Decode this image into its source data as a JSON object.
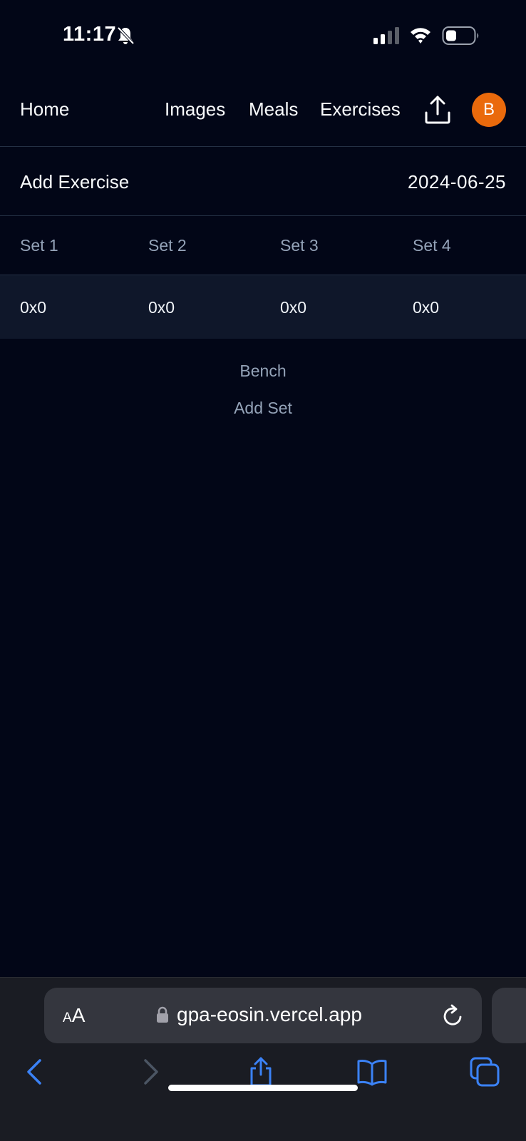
{
  "status_bar": {
    "time": "11:17",
    "icons": [
      "bell-slash-icon",
      "cellular-signal-icon",
      "wifi-icon",
      "battery-icon"
    ]
  },
  "nav": {
    "home": "Home",
    "images": "Images",
    "meals": "Meals",
    "exercises": "Exercises",
    "upload_icon": "upload-icon",
    "avatar_initial": "B"
  },
  "subheader": {
    "add_exercise": "Add Exercise",
    "date": "2024-06-25"
  },
  "table": {
    "headers": [
      "Set 1",
      "Set 2",
      "Set 3",
      "Set 4"
    ],
    "rows": [
      [
        "0x0",
        "0x0",
        "0x0",
        "0x0"
      ]
    ]
  },
  "exercise": {
    "name": "Bench",
    "add_set": "Add Set"
  },
  "browser": {
    "aa_small": "A",
    "aa_large": "A",
    "url": "gpa-eosin.vercel.app",
    "icons": [
      "lock-icon",
      "reload-icon",
      "back-icon",
      "forward-icon",
      "share-icon",
      "bookmarks-icon",
      "tabs-icon"
    ]
  },
  "colors": {
    "background": "#020617",
    "row_background": "#0f172a",
    "muted_text": "#94a3b8",
    "avatar": "#ea6a0c",
    "safari_accent": "#3b82f6"
  }
}
